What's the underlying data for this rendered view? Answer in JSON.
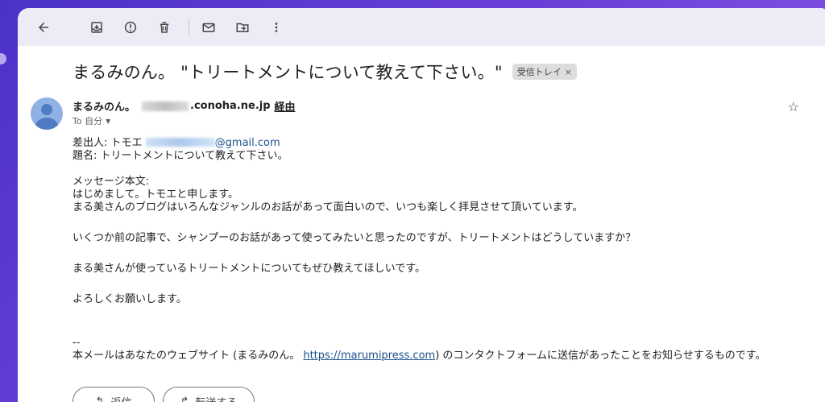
{
  "toolbar": {
    "icons": [
      "back-arrow-icon",
      "archive-icon",
      "report-spam-icon",
      "delete-icon",
      "mark-unread-icon",
      "move-to-icon",
      "more-options-icon"
    ]
  },
  "message": {
    "subject": "まるみのん。 \"トリートメントについて教えて下さい。\"",
    "label": "受信トレイ",
    "label_close": "×",
    "sender_name": "まるみのん。",
    "sender_domain": ".conoha.ne.jp",
    "via": "経由",
    "to": "To 自分",
    "lines": {
      "from_prefix": "差出人: トモエ ",
      "from_email_suffix": "@gmail.com",
      "subject_line": "題名: トリートメントについて教えて下さい。",
      "body_label": "メッセージ本文:",
      "greeting": "はじめまして。トモエと申します。",
      "line1": "まる美さんのブログはいろんなジャンルのお話があって面白いので、いつも楽しく拝見させて頂いています。",
      "line2": "いくつか前の記事で、シャンプーのお話があって使ってみたいと思ったのですが、トリートメントはどうしていますか？",
      "line3": "まる美さんが使っているトリートメントについてもぜひ教えてほしいです。",
      "closing": "よろしくお願いします。",
      "sig_dash": "--",
      "footer_prefix": "本メールはあなたのウェブサイト (まるみのん。 ",
      "footer_url": "https://marumipress.com",
      "footer_suffix": ") のコンタクトフォームに送信があったことをお知らせするものです。"
    }
  },
  "actions": {
    "reply": "返信",
    "forward": "転送する"
  },
  "colors": {
    "background": "#5a3bd0",
    "toolbar": "#ecebf6",
    "link": "#1a4f8b"
  }
}
